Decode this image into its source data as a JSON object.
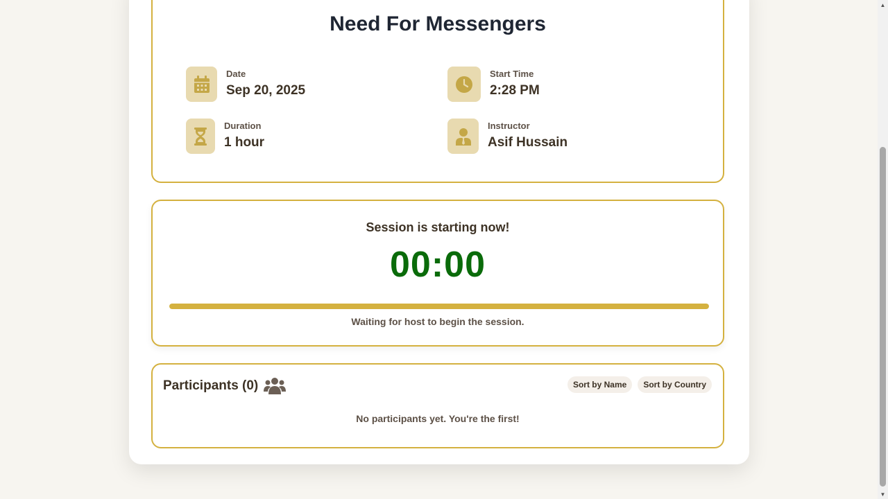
{
  "session": {
    "title": "Need For Messengers",
    "date_label": "Date",
    "date_value": "Sep 20, 2025",
    "start_label": "Start Time",
    "start_value": "2:28 PM",
    "duration_label": "Duration",
    "duration_value": "1 hour",
    "instructor_label": "Instructor",
    "instructor_value": "Asif Hussain"
  },
  "timer": {
    "status": "Session is starting now!",
    "countdown": "00:00",
    "progress_percent": 100,
    "waiting_text": "Waiting for host to begin the session."
  },
  "participants": {
    "title": "Participants (0)",
    "sort_by_name": "Sort by Name",
    "sort_by_country": "Sort by Country",
    "empty_text": "No participants yet. You're the first!"
  },
  "colors": {
    "accent": "#d4b13f",
    "icon_bg": "#e8dab0",
    "icon_fg": "#c4a747",
    "countdown": "#0a6b0a",
    "text": "#3d3225"
  },
  "icons": {
    "date": "calendar-icon",
    "start": "clock-icon",
    "duration": "hourglass-icon",
    "instructor": "user-tie-icon",
    "participants": "users-icon"
  }
}
